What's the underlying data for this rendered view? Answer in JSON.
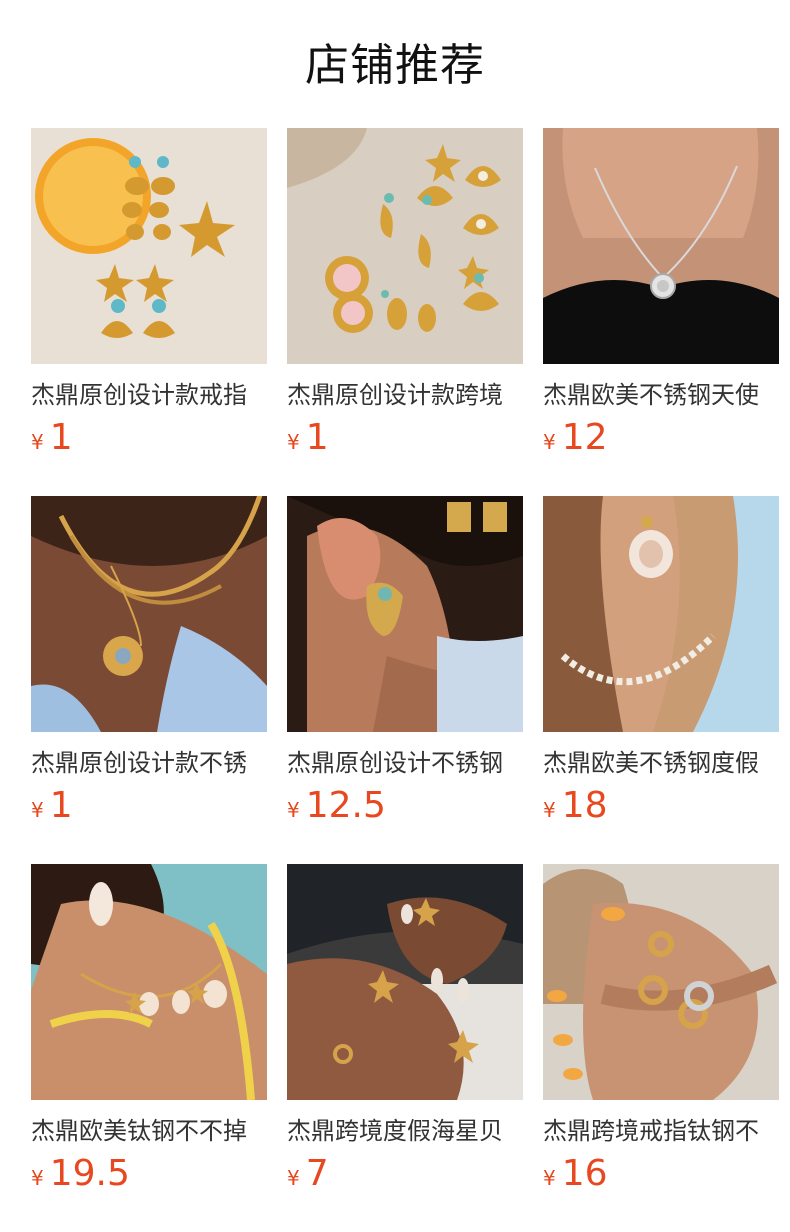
{
  "section": {
    "title": "店铺推荐"
  },
  "colors": {
    "price": "#e8481f",
    "title_text": "#333333",
    "heading": "#111111"
  },
  "products": [
    {
      "title": "杰鼎原创设计款戒指",
      "currency": "¥",
      "price": "1",
      "image": "gold-starfish-earrings-with-lemon"
    },
    {
      "title": "杰鼎原创设计款跨境",
      "currency": "¥",
      "price": "1",
      "image": "gold-shell-jewelry-flatlay"
    },
    {
      "title": "杰鼎欧美不锈钢天使",
      "currency": "¥",
      "price": "12",
      "image": "silver-coin-pendant-necklace"
    },
    {
      "title": "杰鼎原创设计款不锈",
      "currency": "¥",
      "price": "1",
      "image": "layered-gold-chain-necklace"
    },
    {
      "title": "杰鼎原创设计不锈钢",
      "currency": "¥",
      "price": "12.5",
      "image": "gold-shell-earring-on-ear"
    },
    {
      "title": "杰鼎欧美不锈钢度假",
      "currency": "¥",
      "price": "18",
      "image": "shell-earring-and-bead-necklace"
    },
    {
      "title": "杰鼎欧美钛钢不不掉",
      "currency": "¥",
      "price": "19.5",
      "image": "seashell-charm-necklace"
    },
    {
      "title": "杰鼎跨境度假海星贝",
      "currency": "¥",
      "price": "7",
      "image": "starfish-rings-on-hands"
    },
    {
      "title": "杰鼎跨境戒指钛钢不",
      "currency": "¥",
      "price": "16",
      "image": "stacked-rings-on-hand"
    }
  ]
}
